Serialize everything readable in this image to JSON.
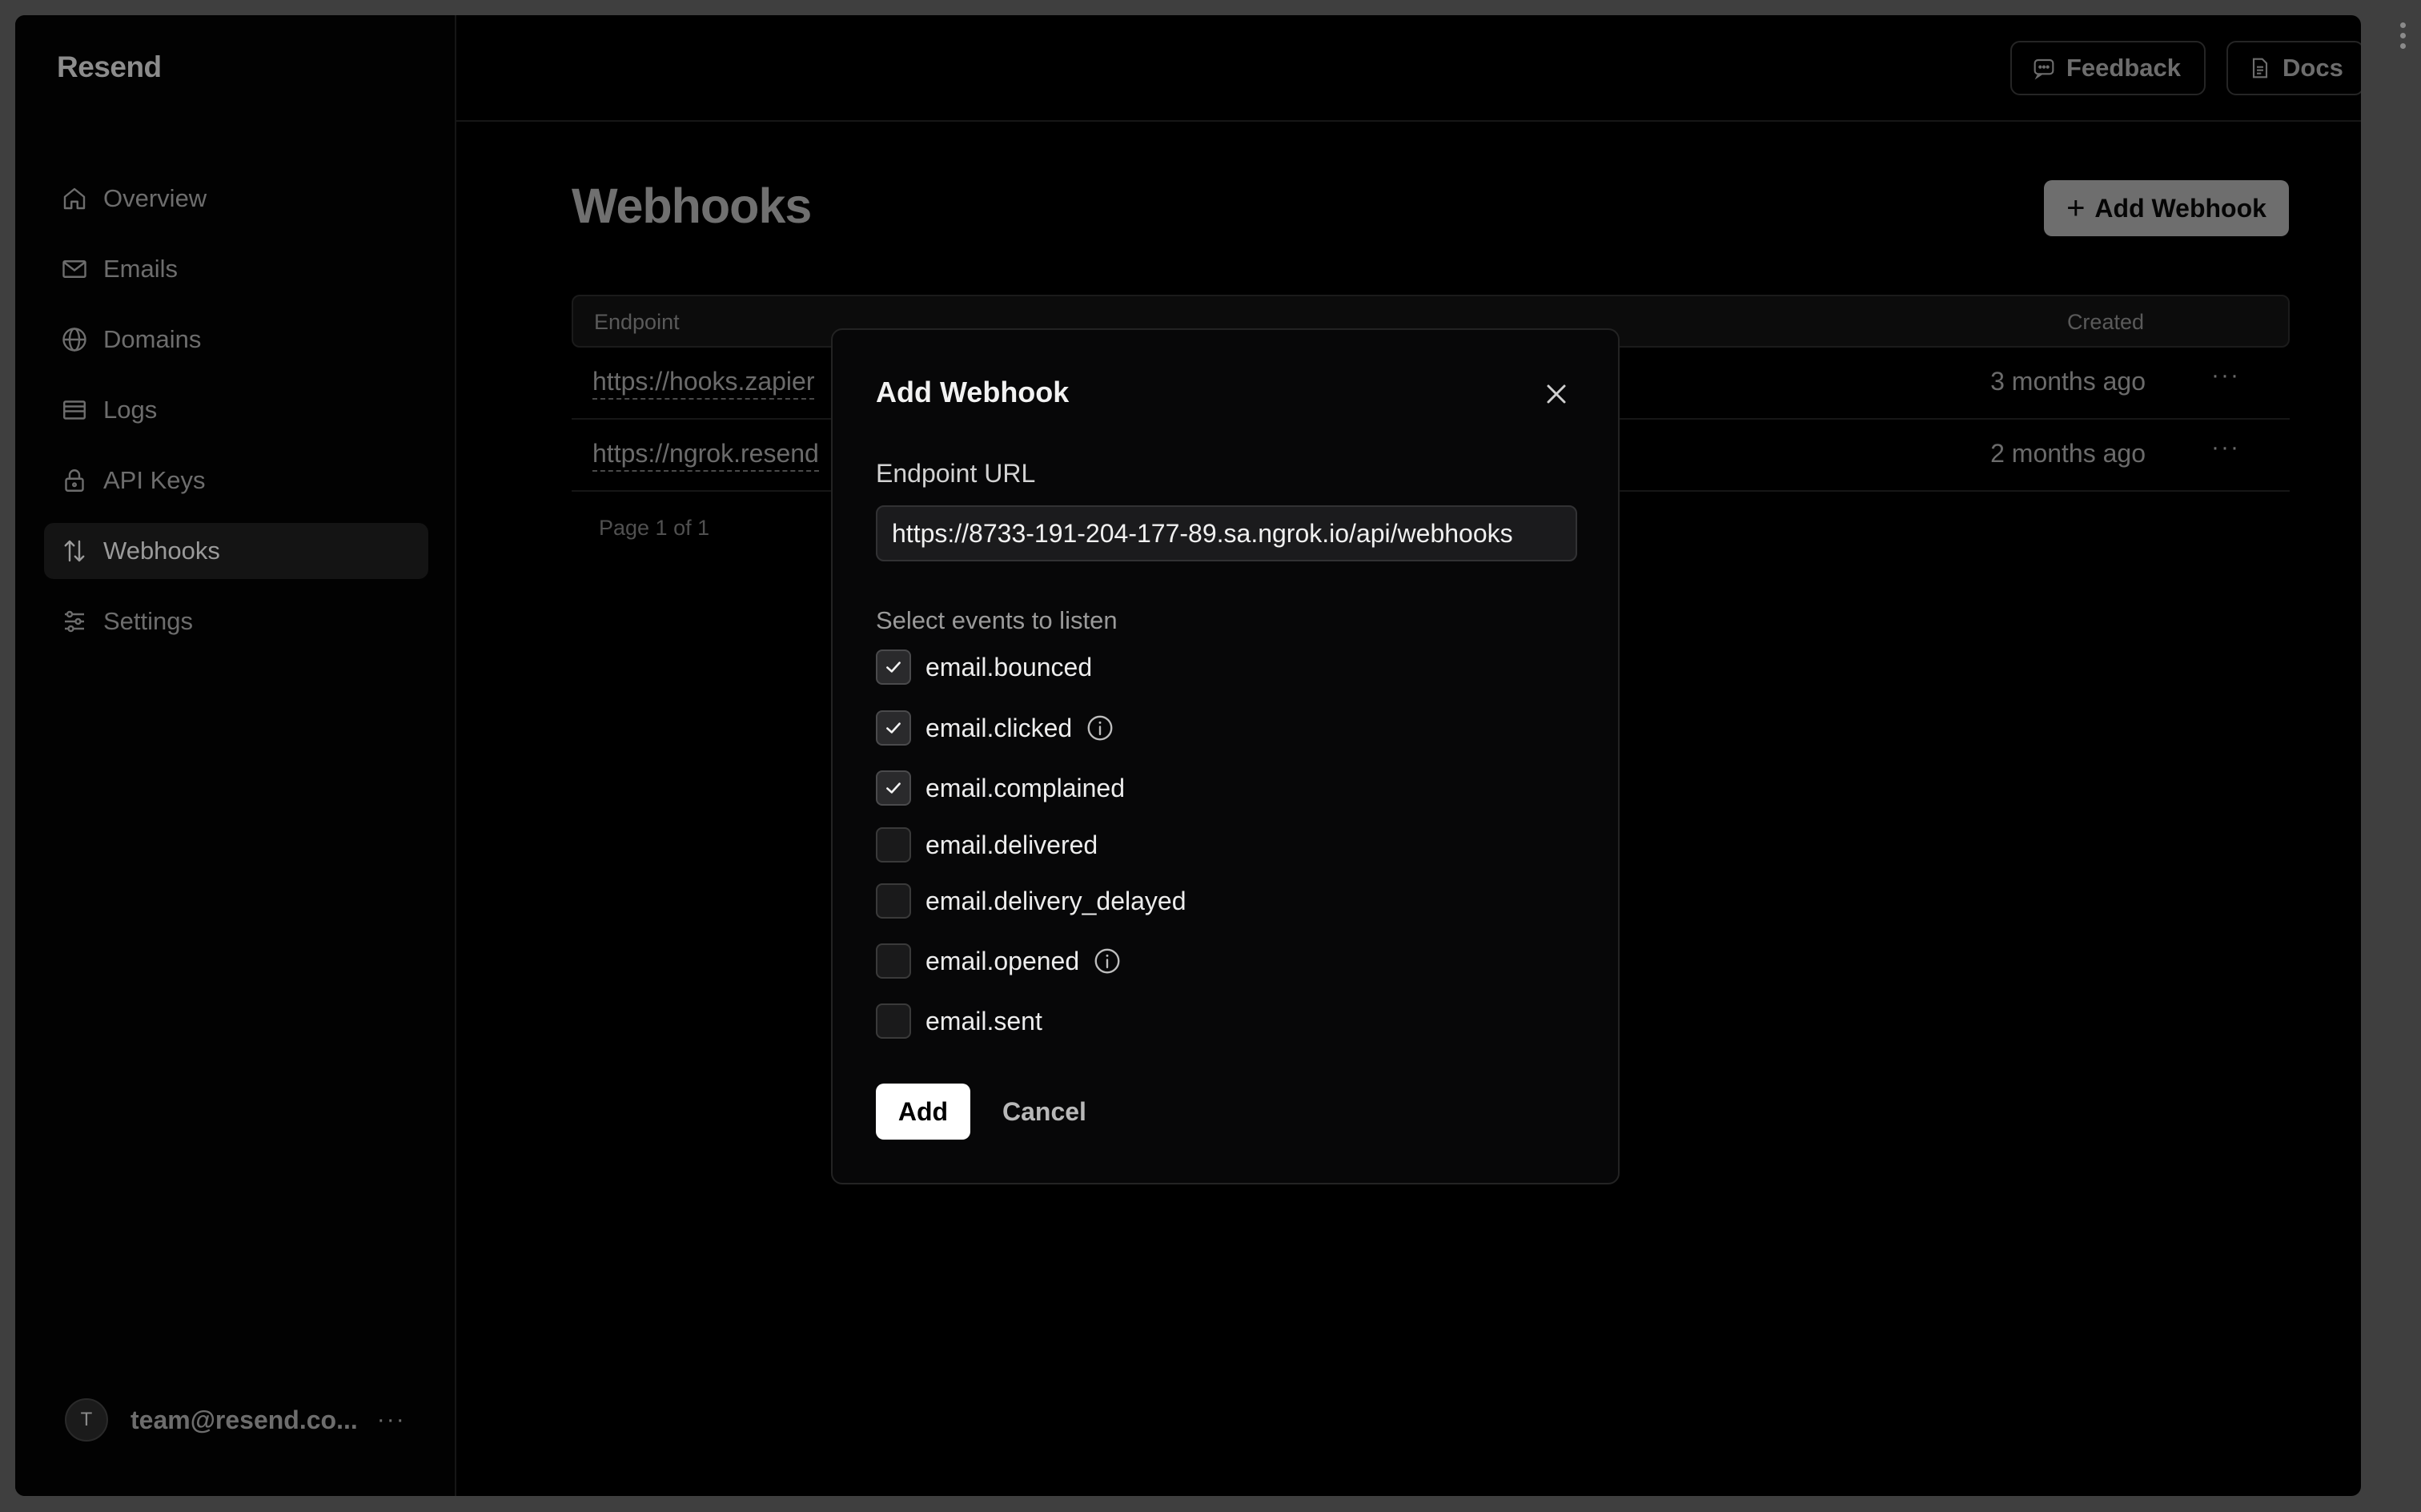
{
  "app": {
    "brand": "Resend"
  },
  "sidebar": {
    "items": [
      {
        "label": "Overview",
        "icon": "home-icon",
        "active": false
      },
      {
        "label": "Emails",
        "icon": "mail-icon",
        "active": false
      },
      {
        "label": "Domains",
        "icon": "globe-icon",
        "active": false
      },
      {
        "label": "Logs",
        "icon": "logs-icon",
        "active": false
      },
      {
        "label": "API Keys",
        "icon": "lock-icon",
        "active": false
      },
      {
        "label": "Webhooks",
        "icon": "arrows-updown-icon",
        "active": true
      },
      {
        "label": "Settings",
        "icon": "sliders-icon",
        "active": false
      }
    ],
    "account": {
      "initial": "T",
      "email": "team@resend.co...",
      "more": "···"
    }
  },
  "topbar": {
    "feedback_label": "Feedback",
    "docs_label": "Docs"
  },
  "page": {
    "title": "Webhooks",
    "add_button": "Add Webhook",
    "add_button_icon": "+",
    "table": {
      "headers": {
        "endpoint": "Endpoint",
        "created": "Created"
      },
      "rows": [
        {
          "endpoint": "https://hooks.zapier",
          "created": "3 months ago",
          "more": "···"
        },
        {
          "endpoint": "https://ngrok.resend",
          "created": "2 months ago",
          "more": "···"
        }
      ]
    },
    "pager": "Page 1 of 1"
  },
  "modal": {
    "title": "Add Webhook",
    "endpoint_label": "Endpoint URL",
    "endpoint_value": "https://8733-191-204-177-89.sa.ngrok.io/api/webhooks",
    "events_label": "Select events to listen",
    "events": [
      {
        "name": "email.bounced",
        "checked": true,
        "info": false
      },
      {
        "name": "email.clicked",
        "checked": true,
        "info": true
      },
      {
        "name": "email.complained",
        "checked": true,
        "info": false
      },
      {
        "name": "email.delivered",
        "checked": false,
        "info": false
      },
      {
        "name": "email.delivery_delayed",
        "checked": false,
        "info": false
      },
      {
        "name": "email.opened",
        "checked": false,
        "info": true
      },
      {
        "name": "email.sent",
        "checked": false,
        "info": false
      }
    ],
    "add_label": "Add",
    "cancel_label": "Cancel"
  }
}
